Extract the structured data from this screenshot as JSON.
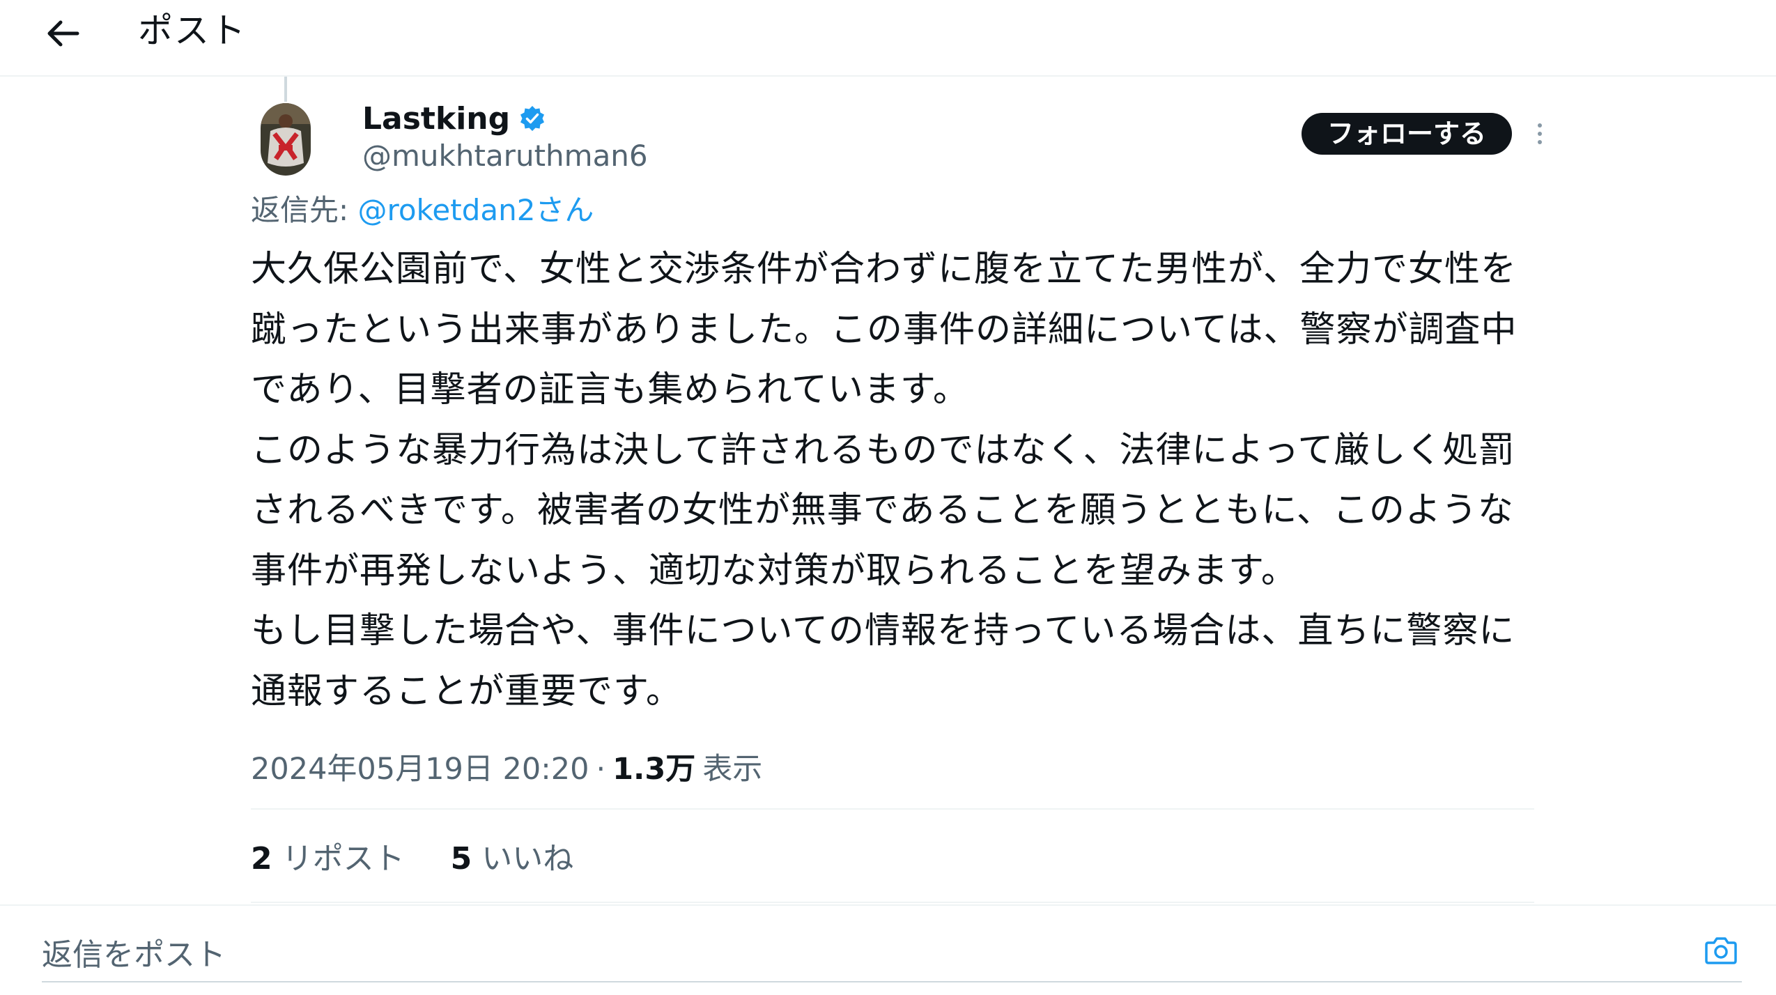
{
  "header": {
    "back_icon": "arrow-left-icon",
    "title": "ポスト"
  },
  "author": {
    "display_name": "Lastking",
    "handle": "@mukhtaruthman6",
    "verified": true,
    "verified_color": "#1d9bf0"
  },
  "actions": {
    "follow_label": "フォローする",
    "more_icon": "more-vertical-icon"
  },
  "reply_to": {
    "prefix": "返信先: ",
    "mention": "@roketdan2さん"
  },
  "tweet": {
    "text": "大久保公園前で、女性と交渉条件が合わずに腹を立てた男性が、全力で女性を蹴ったという出来事がありました。この事件の詳細については、警察が調査中であり、目撃者の証言も集められています。\nこのような暴力行為は決して許されるものではなく、法律によって厳しく処罰されるべきです。被害者の女性が無事であることを願うとともに、このような事件が再発しないよう、適切な対策が取られることを望みます。\nもし目撃した場合や、事件についての情報を持っている場合は、直ちに警察に通報することが重要です。"
  },
  "meta": {
    "timestamp": "2024年05月19日 20:20",
    "separator": "·",
    "views_count": "1.3万",
    "views_label": "表示"
  },
  "stats": {
    "reposts_count": "2",
    "reposts_label": "リポスト",
    "likes_count": "5",
    "likes_label": "いいね"
  },
  "reply_composer": {
    "placeholder": "返信をポスト",
    "camera_icon": "camera-icon",
    "accent_color": "#1d9bf0"
  }
}
